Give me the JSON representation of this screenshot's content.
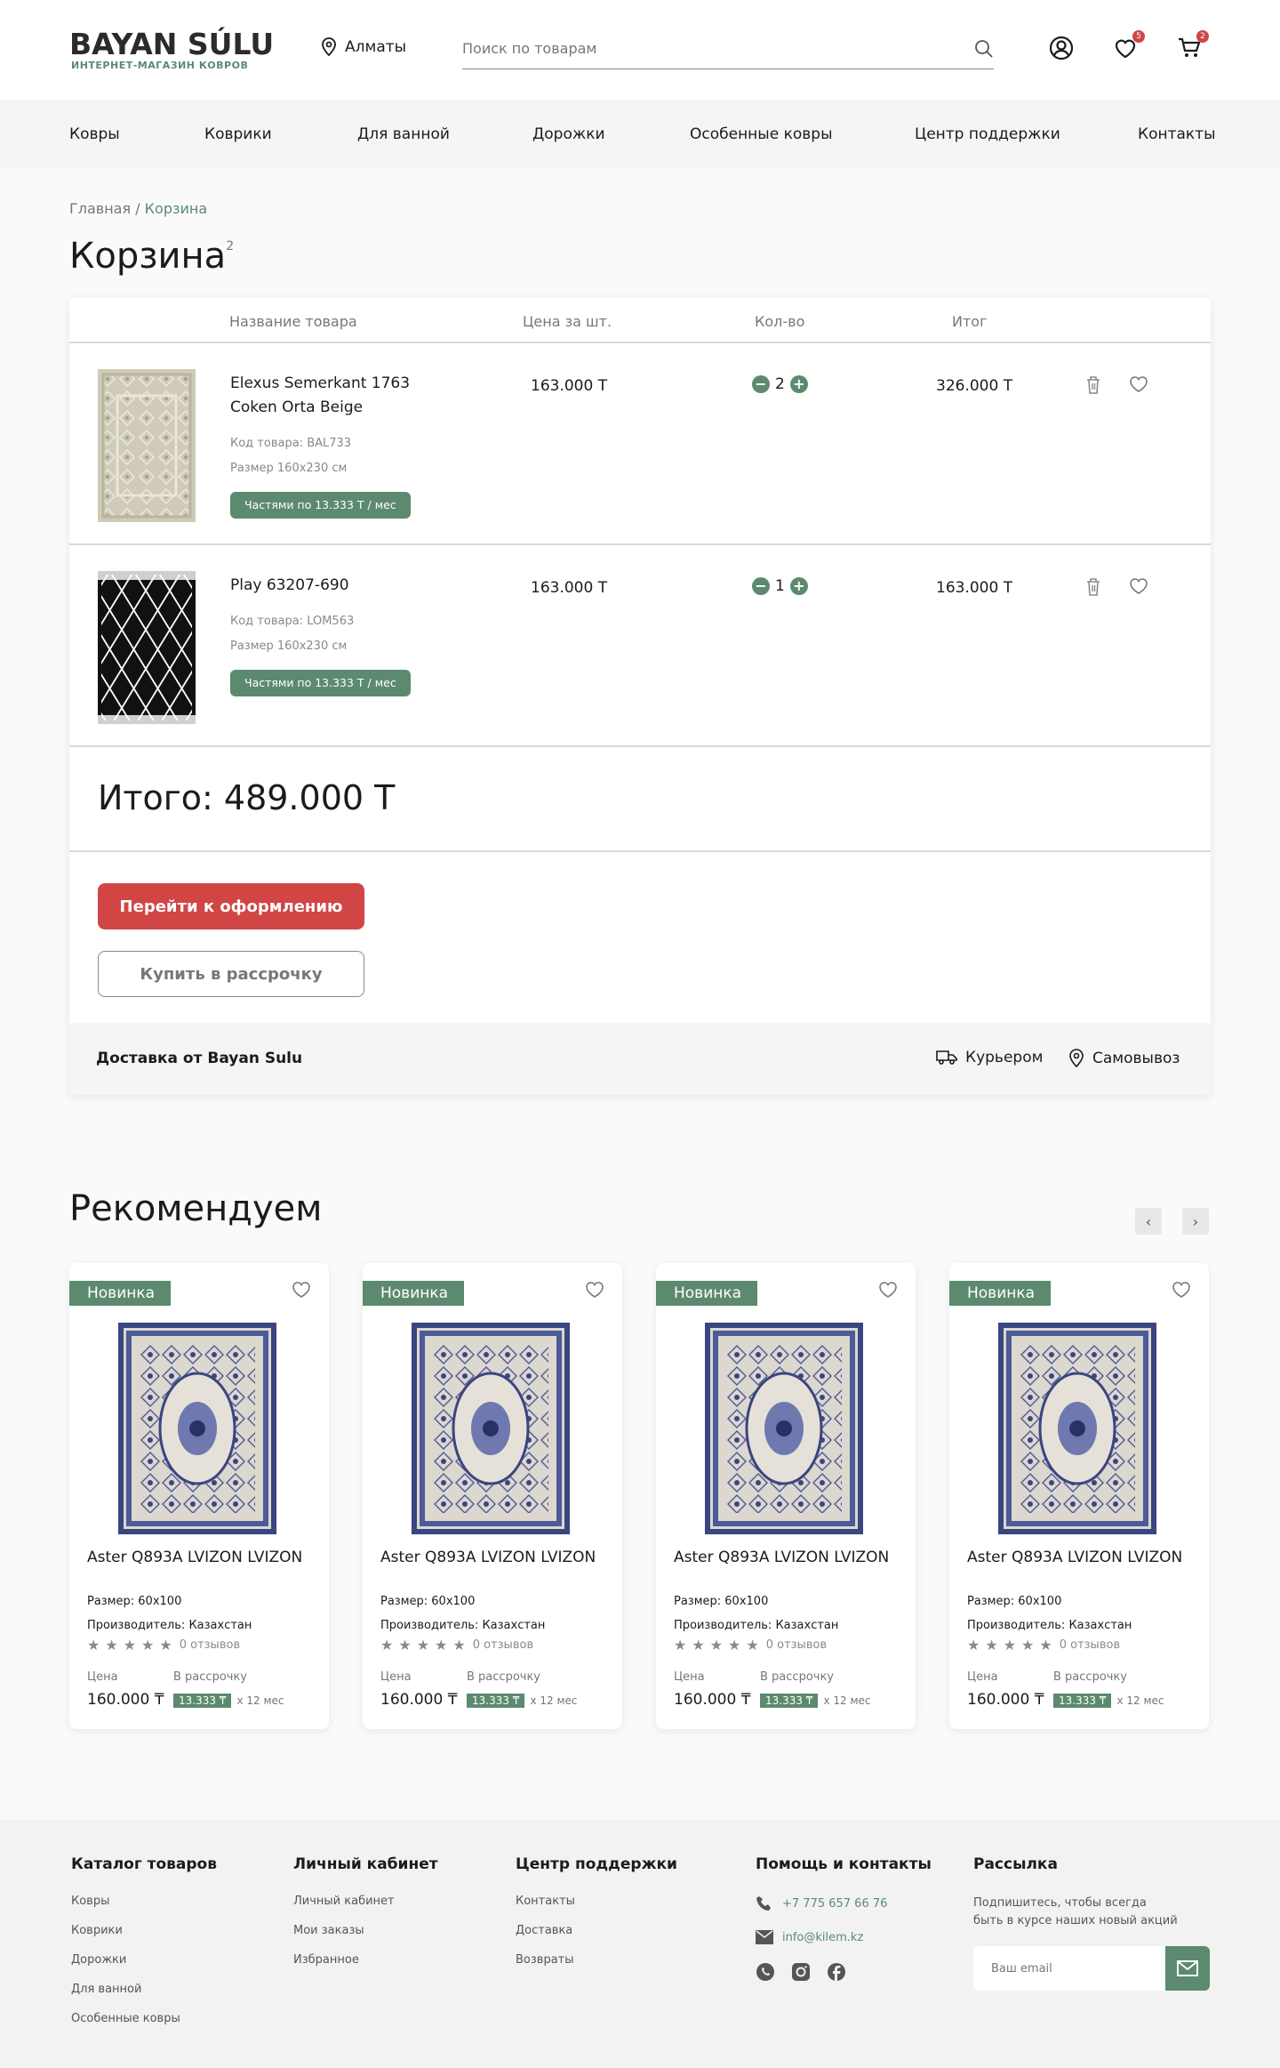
{
  "header": {
    "logo_main": "BAYAN SÚLU",
    "logo_sub": "ИНТЕРНЕТ-МАГАЗИН КОВРОВ",
    "city": "Алматы",
    "search_placeholder": "Поиск по товарам",
    "favorites_count": "5",
    "cart_count": "2"
  },
  "nav": [
    "Ковры",
    "Коврики",
    "Для ванной",
    "Дорожки",
    "Особенные ковры",
    "Центр поддержки",
    "Контакты"
  ],
  "breadcrumb": {
    "home": "Главная",
    "sep": " / ",
    "current": "Корзина"
  },
  "page_title": "Корзина",
  "page_title_count": "2",
  "cart": {
    "columns": {
      "name": "Название товара",
      "price": "Цена за шт.",
      "qty": "Кол-во",
      "total": "Итог"
    },
    "items": [
      {
        "name": "Elexus Semerkant 1763 Coken Orta Beige",
        "code": "Код товара: BAL733",
        "size": "Размер 160х230 см",
        "installment": "Частями по 13.333 Т / мес",
        "price": "163.000 Т",
        "qty": "2",
        "total": "326.000 Т"
      },
      {
        "name": "Play 63207-690",
        "code": "Код товара: LOM563",
        "size": "Размер 160х230 см",
        "installment": "Частями по 13.333 Т / мес",
        "price": "163.000 Т",
        "qty": "1",
        "total": "163.000 Т"
      }
    ],
    "grand_total": "Итого: 489.000 Т",
    "checkout_button": "Перейти к оформлению",
    "installment_button": "Купить в рассрочку",
    "delivery_title": "Доставка от Bayan Sulu",
    "delivery_courier": "Курьером",
    "delivery_pickup": "Самовывоз"
  },
  "recommend": {
    "title": "Рекомендуем",
    "cards": [
      {
        "badge": "Новинка",
        "name": "Aster Q893A LVIZON LVIZON",
        "size": "Размер: 60х100",
        "maker": "Производитель: Казахстан",
        "reviews": "0 отзывов",
        "price_label": "Цена",
        "installment_label": "В рассрочку",
        "price": "160.000 ₸",
        "installment_value": "13.333 ₸",
        "installment_term": "x 12 мес"
      },
      {
        "badge": "Новинка",
        "name": "Aster Q893A LVIZON LVIZON",
        "size": "Размер: 60х100",
        "maker": "Производитель: Казахстан",
        "reviews": "0 отзывов",
        "price_label": "Цена",
        "installment_label": "В рассрочку",
        "price": "160.000 ₸",
        "installment_value": "13.333 ₸",
        "installment_term": "x 12 мес"
      },
      {
        "badge": "Новинка",
        "name": "Aster Q893A LVIZON LVIZON",
        "size": "Размер: 60х100",
        "maker": "Производитель: Казахстан",
        "reviews": "0 отзывов",
        "price_label": "Цена",
        "installment_label": "В рассрочку",
        "price": "160.000 ₸",
        "installment_value": "13.333 ₸",
        "installment_term": "x 12 мес"
      },
      {
        "badge": "Новинка",
        "name": "Aster Q893A LVIZON LVIZON",
        "size": "Размер: 60х100",
        "maker": "Производитель: Казахстан",
        "reviews": "0 отзывов",
        "price_label": "Цена",
        "installment_label": "В рассрочку",
        "price": "160.000 ₸",
        "installment_value": "13.333 ₸",
        "installment_term": "x 12 мес"
      }
    ]
  },
  "footer": {
    "catalog": {
      "title": "Каталог товаров",
      "links": [
        "Ковры",
        "Коврики",
        "Дорожки",
        "Для ванной",
        "Особенные ковры"
      ]
    },
    "account": {
      "title": "Личный кабинет",
      "links": [
        "Личный кабинет",
        "Мои заказы",
        "Избранное"
      ]
    },
    "support": {
      "title": "Центр поддержки",
      "links": [
        "Контакты",
        "Доставка",
        "Возвраты"
      ]
    },
    "contacts": {
      "title": "Помощь и контакты",
      "phone": "+7 775 657 66 76",
      "email": "info@kilem.kz"
    },
    "newsletter": {
      "title": "Рассылка",
      "text": "Подпишитесь, чтобы всегда быть в курсе наших новый акций",
      "placeholder": "Ваш email"
    }
  },
  "colors": {
    "accent": "#5c8a6f",
    "danger": "#d24545"
  }
}
